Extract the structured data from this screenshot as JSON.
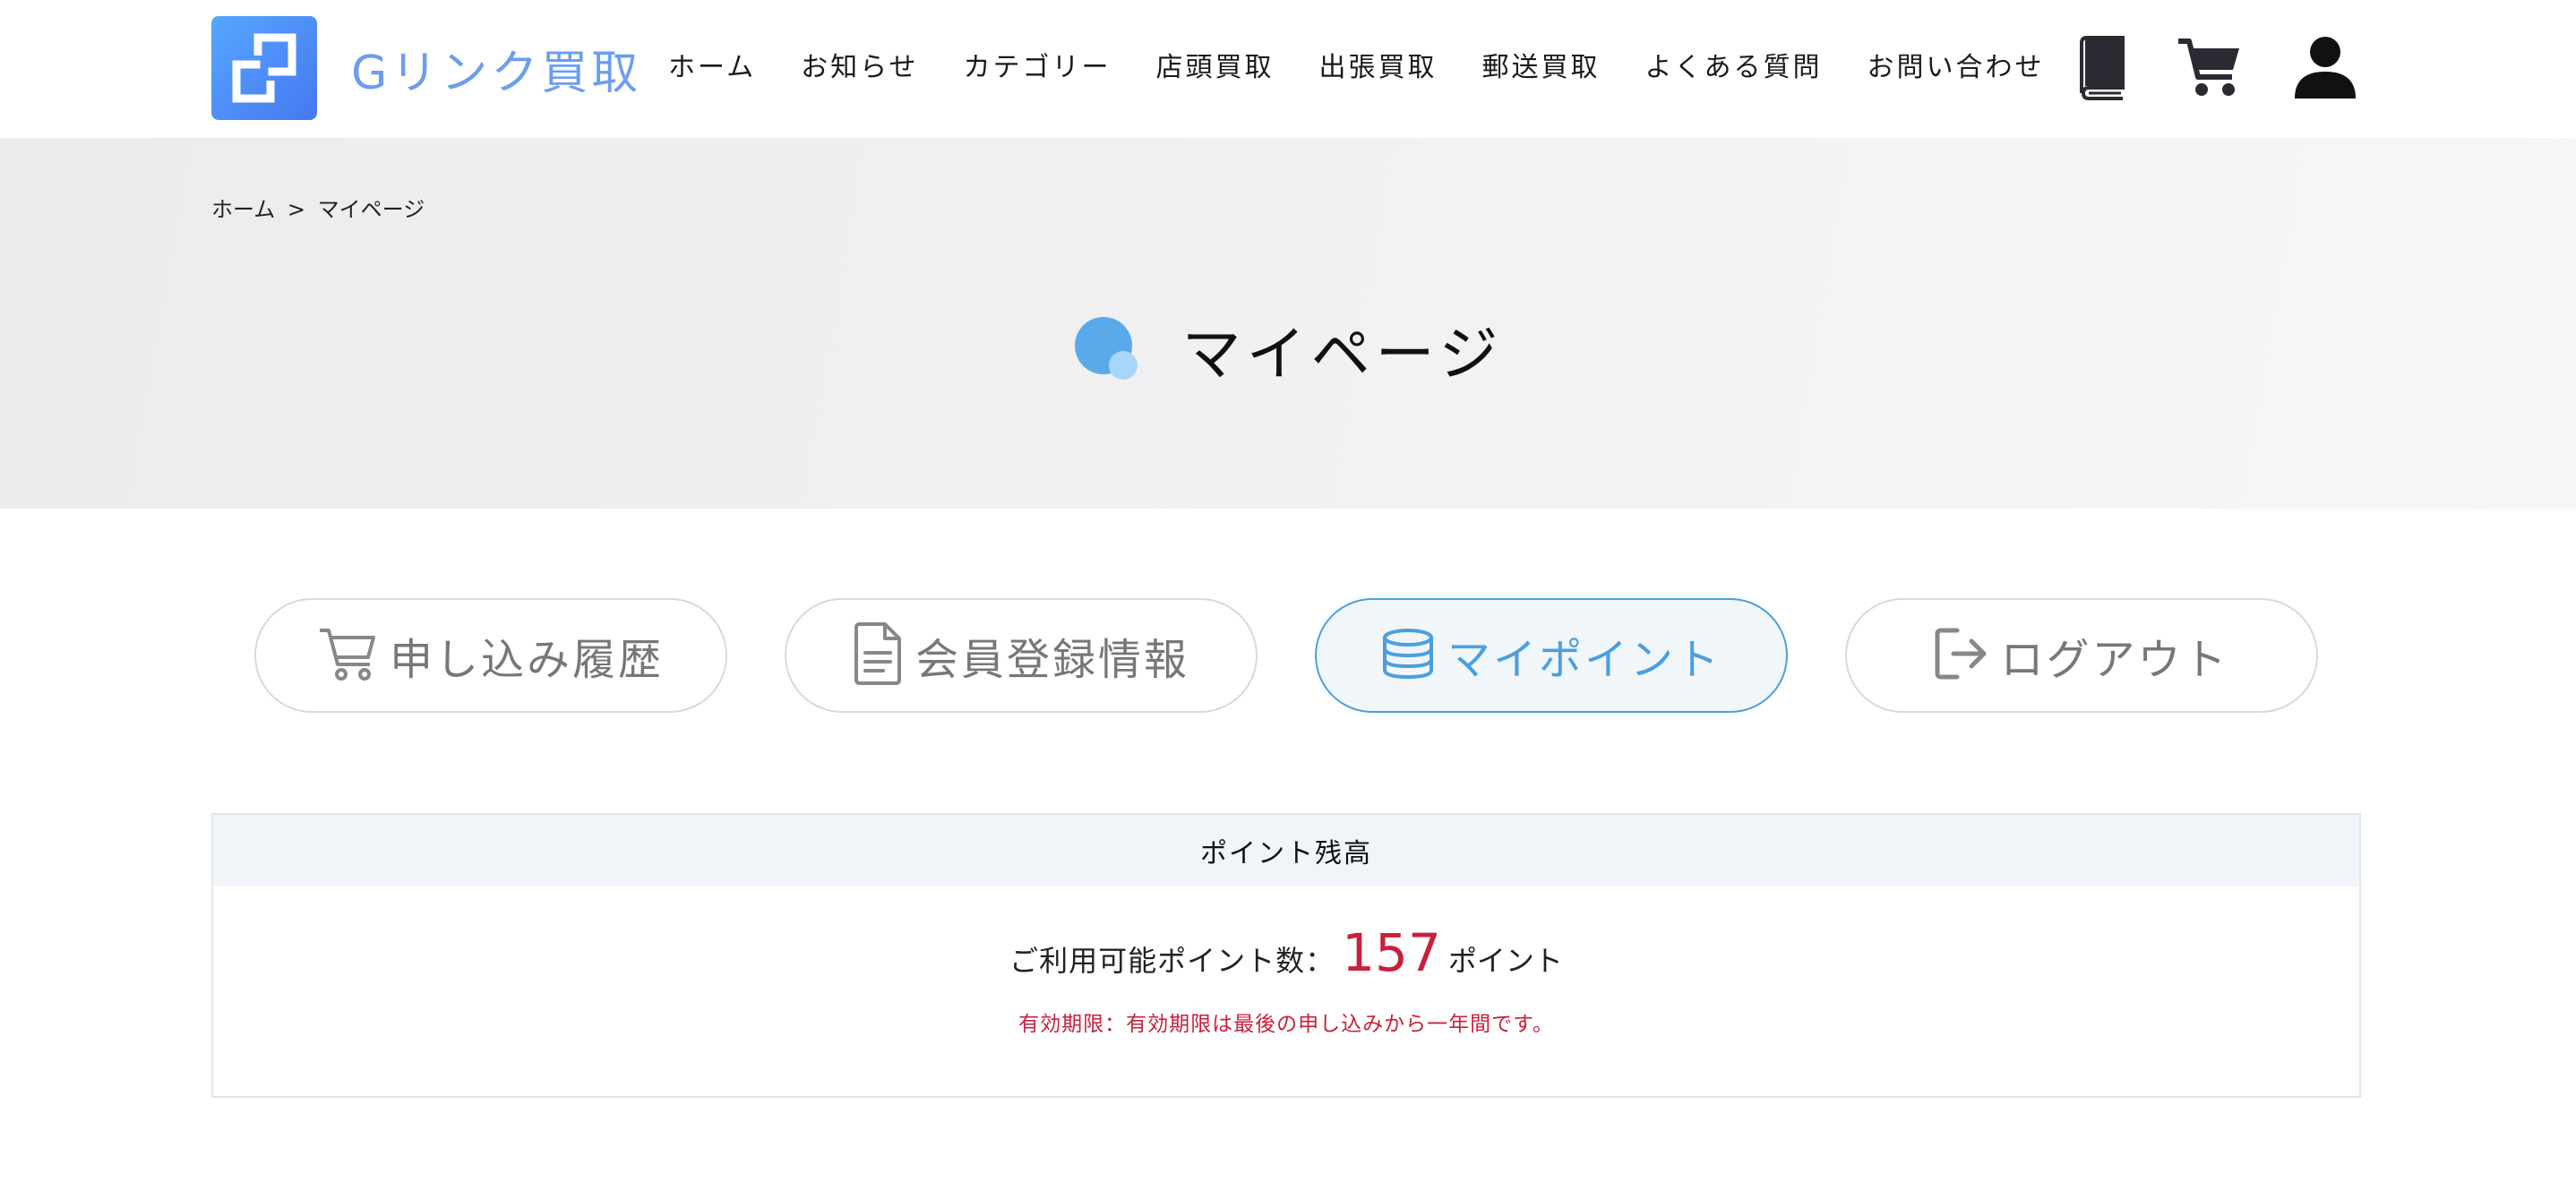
{
  "header": {
    "logo_text": "Gリンク買取",
    "nav": [
      {
        "label": "ホーム"
      },
      {
        "label": "お知らせ"
      },
      {
        "label": "カテゴリー"
      },
      {
        "label": "店頭買取"
      },
      {
        "label": "出張買取"
      },
      {
        "label": "郵送買取"
      },
      {
        "label": "よくある質問"
      },
      {
        "label": "お問い合わせ"
      }
    ],
    "icons": [
      "book-icon",
      "cart-icon",
      "user-icon"
    ]
  },
  "breadcrumb": {
    "home": "ホーム",
    "separator": ">",
    "current": "マイページ"
  },
  "page_title": "マイページ",
  "tabs": [
    {
      "label": "申し込み履歴",
      "icon": "cart-icon",
      "active": false
    },
    {
      "label": "会員登録情報",
      "icon": "document-icon",
      "active": false
    },
    {
      "label": "マイポイント",
      "icon": "coins-icon",
      "active": true
    },
    {
      "label": "ログアウト",
      "icon": "logout-icon",
      "active": false
    }
  ],
  "points_panel": {
    "heading": "ポイント残高",
    "available_label": "ご利用可能ポイント数：",
    "available_value": "157",
    "unit": "ポイント",
    "expiry_note": "有効期限：有効期限は最後の申し込みから一年間です。"
  },
  "colors": {
    "accent_blue": "#4a9fe0",
    "logo_blue": "#6c9ef0",
    "points_red": "#c8203c",
    "hero_gray": "#efeff0"
  }
}
